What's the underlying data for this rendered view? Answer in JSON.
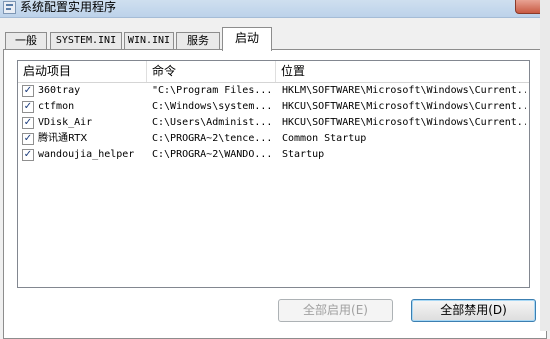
{
  "window": {
    "title": "系统配置实用程序"
  },
  "tabs": [
    {
      "label": "一般"
    },
    {
      "label": "SYSTEM.INI"
    },
    {
      "label": "WIN.INI"
    },
    {
      "label": "服务"
    },
    {
      "label": "启动",
      "active": true
    }
  ],
  "list": {
    "columns": [
      "启动项目",
      "命令",
      "位置"
    ],
    "rows": [
      {
        "checked": true,
        "name": "360tray",
        "command": "\"C:\\Program Files...",
        "location": "HKLM\\SOFTWARE\\Microsoft\\Windows\\Current..."
      },
      {
        "checked": true,
        "name": "ctfmon",
        "command": "C:\\Windows\\system...",
        "location": "HKCU\\SOFTWARE\\Microsoft\\Windows\\Current..."
      },
      {
        "checked": true,
        "name": "VDisk_Air",
        "command": "C:\\Users\\Administ...",
        "location": "HKCU\\SOFTWARE\\Microsoft\\Windows\\Current..."
      },
      {
        "checked": true,
        "name": "腾讯通RTX",
        "command": "C:\\PROGRA~2\\tence...",
        "location": "Common Startup"
      },
      {
        "checked": true,
        "name": "wandoujia_helper",
        "command": "C:\\PROGRA~2\\WANDO...",
        "location": "Startup"
      }
    ]
  },
  "buttons": {
    "enable_all": "全部启用(E)",
    "disable_all": "全部禁用(D)"
  },
  "checkmark": "✓"
}
